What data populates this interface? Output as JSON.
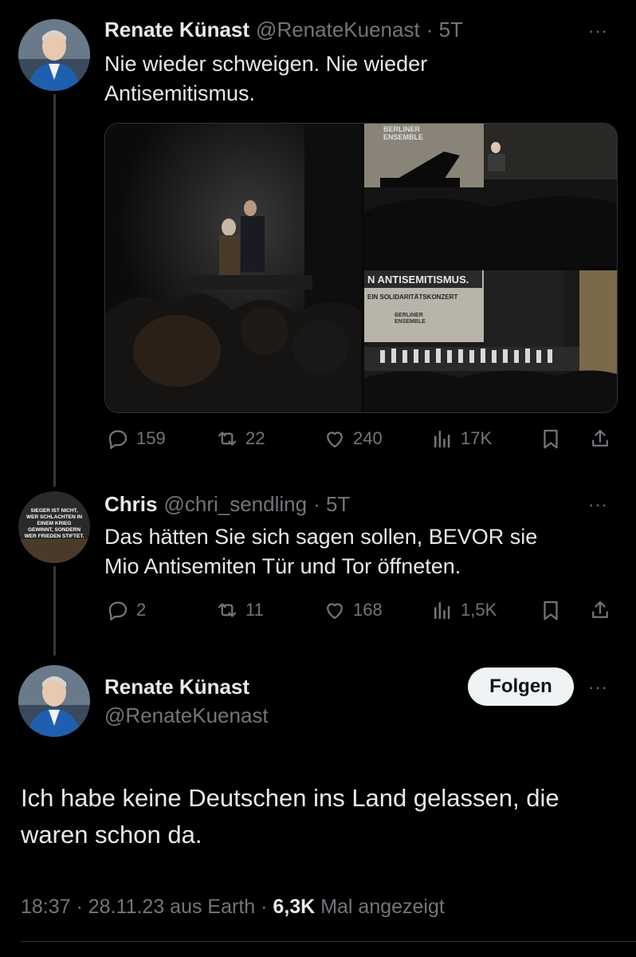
{
  "tweet1": {
    "name": "Renate Künast",
    "handle": "@RenateKuenast",
    "age": "· 5T",
    "more": "···",
    "text_line1": "Nie wieder schweigen. Nie wieder",
    "text_line2": "Antisemitismus.",
    "media": {
      "img2_sign": "BERLINER ENSEMBLE",
      "img3_banner1": "N ANTISEMITISMUS.",
      "img3_banner2": "EIN SOLIDARITÄTSKONZERT",
      "img3_sign": "BERLINER ENSEMBLE"
    },
    "stats": {
      "replies": "159",
      "retweets": "22",
      "likes": "240",
      "views": "17K"
    }
  },
  "tweet2": {
    "name": "Chris",
    "handle": "@chri_sendling",
    "age": "· 5T",
    "more": "···",
    "avatar_text": "SIEGER IST NICHT, WER SCHLACHTEN IN EINEM KRIEG GEWINNT, SONDERN WER FRIEDEN STIFTET.",
    "text_line1": "Das hätten Sie sich sagen sollen, BEVOR sie",
    "text_line2": "Mio Antisemiten Tür und Tor öffneten.",
    "stats": {
      "replies": "2",
      "retweets": "11",
      "likes": "168",
      "views": "1,5K"
    }
  },
  "tweet3": {
    "name": "Renate Künast",
    "handle": "@RenateKuenast",
    "follow_label": "Folgen",
    "more": "···",
    "text_line1": "Ich habe keine Deutschen ins Land gelassen, die",
    "text_line2": "waren schon da.",
    "meta_time": "18:37 · 28.11.23 aus Earth ·",
    "meta_views": "6,3K",
    "meta_suffix": "Mal angezeigt"
  },
  "colors": {
    "background": "#000000",
    "text": "#e7e9ea",
    "muted": "#71767b",
    "line": "#333639"
  }
}
